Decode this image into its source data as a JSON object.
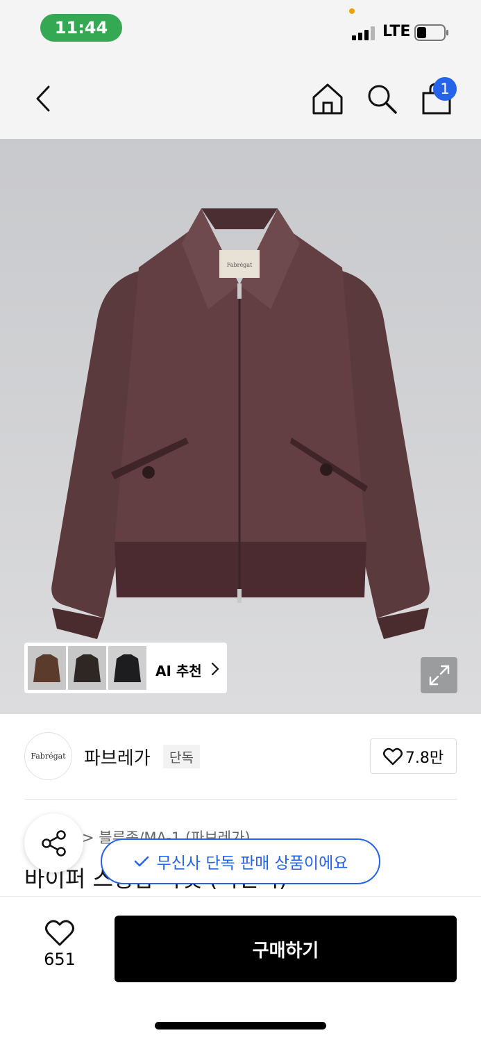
{
  "status_bar": {
    "time": "11:44",
    "network": "LTE",
    "time_pill_color": "#34a853"
  },
  "header": {
    "cart_badge": "1",
    "icons": [
      "back-icon",
      "home-icon",
      "search-icon",
      "cart-icon"
    ]
  },
  "product_image": {
    "label_text": "Fabrégat",
    "thumbnails": [
      "brown-jacket-thumbnail",
      "dark-leather-jacket-thumbnail",
      "black-jacket-thumbnail"
    ],
    "ai_recommend_label": "AI 추천"
  },
  "brand": {
    "logo_text": "Fabrégat",
    "name": "파브레가",
    "tag": "단독",
    "likes": "7.8만"
  },
  "breadcrumb": "블루종/MA-1 (파브레가)",
  "product_title": "바이퍼 스윙탑 자켓 (버건디)",
  "toast": {
    "text": "무신사 단독 판매 상품이에요",
    "accent": "#2563eb"
  },
  "bottom_bar": {
    "wish_count": "651",
    "buy_label": "구매하기"
  }
}
